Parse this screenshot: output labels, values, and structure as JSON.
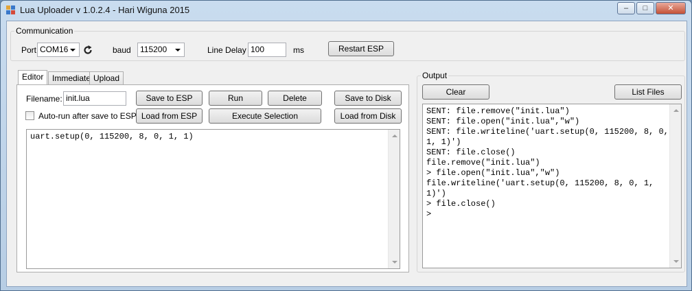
{
  "window": {
    "title": "Lua Uploader v 1.0.2.4 - Hari Wiguna 2015",
    "minimize": "–",
    "maximize": "□",
    "close": "✕"
  },
  "communication": {
    "group_title": "Communication",
    "port_label": "Port",
    "port_value": "COM16",
    "baud_label": "baud",
    "baud_value": "115200",
    "line_delay_label": "Line Delay",
    "line_delay_value": "100",
    "ms_label": "ms",
    "restart_button": "Restart ESP"
  },
  "tabs": [
    "Editor",
    "Immediate",
    "Upload"
  ],
  "editor": {
    "filename_label": "Filename:",
    "filename_value": "init.lua",
    "autorun_label": "Auto-run after save to ESP",
    "autorun_checked": false,
    "buttons": {
      "save_to_esp": "Save to ESP",
      "run": "Run",
      "delete": "Delete",
      "save_to_disk": "Save to Disk",
      "load_from_esp": "Load from ESP",
      "execute_selection": "Execute Selection",
      "load_from_disk": "Load from Disk"
    },
    "code": "uart.setup(0, 115200, 8, 0, 1, 1)"
  },
  "output": {
    "group_title": "Output",
    "clear_button": "Clear",
    "list_files_button": "List Files",
    "lines": [
      "SENT: file.remove(\"init.lua\")",
      "SENT: file.open(\"init.lua\",\"w\")",
      "SENT: file.writeline('uart.setup(0, 115200, 8, 0,",
      "1, 1)')",
      "SENT: file.close()",
      "file.remove(\"init.lua\")",
      "> file.open(\"init.lua\",\"w\")",
      "file.writeline('uart.setup(0, 115200, 8, 0, 1,",
      "1)')",
      "> file.close()",
      ">"
    ]
  },
  "colors": {
    "title_bar": "#c9dcef",
    "client_bg": "#f0f0f0",
    "close_button": "#c45136"
  }
}
